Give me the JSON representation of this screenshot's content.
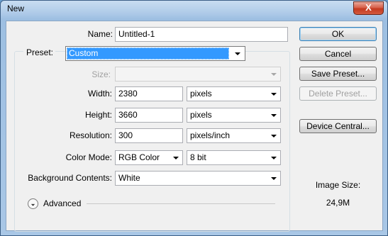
{
  "window": {
    "title": "New",
    "close_glyph": "X"
  },
  "form": {
    "name_label": "Name:",
    "name_value": "Untitled-1",
    "preset_label": "Preset:",
    "preset_value": "Custom",
    "size_label": "Size:",
    "size_value": "",
    "width_label": "Width:",
    "width_value": "2380",
    "width_unit": "pixels",
    "height_label": "Height:",
    "height_value": "3660",
    "height_unit": "pixels",
    "resolution_label": "Resolution:",
    "resolution_value": "300",
    "resolution_unit": "pixels/inch",
    "color_mode_label": "Color Mode:",
    "color_mode_value": "RGB Color",
    "bit_depth_value": "8 bit",
    "background_label": "Background Contents:",
    "background_value": "White",
    "advanced_label": "Advanced"
  },
  "buttons": {
    "ok": "OK",
    "cancel": "Cancel",
    "save_preset": "Save Preset...",
    "delete_preset": "Delete Preset...",
    "device_central": "Device Central..."
  },
  "info": {
    "image_size_label": "Image Size:",
    "image_size_value": "24,9M"
  },
  "icons": {
    "advanced": "chevron-double-down-icon",
    "close": "close-icon"
  },
  "colors": {
    "selection": "#3399ff",
    "default_button_border": "#3c7fb1"
  }
}
